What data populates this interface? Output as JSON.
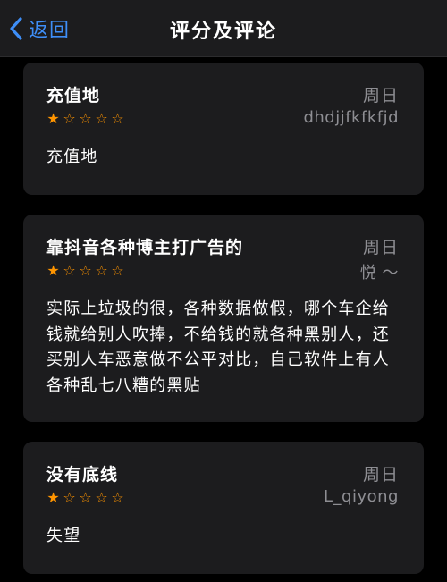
{
  "nav": {
    "back_label": "返回",
    "title": "评分及评论"
  },
  "accent_color": "#3e8ef7",
  "star_color": "#ff9500",
  "reviews": [
    {
      "title": "充值地",
      "date": "周日",
      "rating": 1,
      "max_rating": 5,
      "author": "dhdjjfkfkfjd",
      "body": "充值地"
    },
    {
      "title": "靠抖音各种博主打广告的",
      "date": "周日",
      "rating": 1,
      "max_rating": 5,
      "author": "悦 ～",
      "body": "实际上垃圾的很，各种数据做假，哪个车企给钱就给别人吹捧，不给钱的就各种黑别人，还买别人车恶意做不公平对比，自己软件上有人各种乱七八糟的黑贴"
    },
    {
      "title": "没有底线",
      "date": "周日",
      "rating": 1,
      "max_rating": 5,
      "author": "L_qiyong",
      "body": "失望"
    }
  ]
}
